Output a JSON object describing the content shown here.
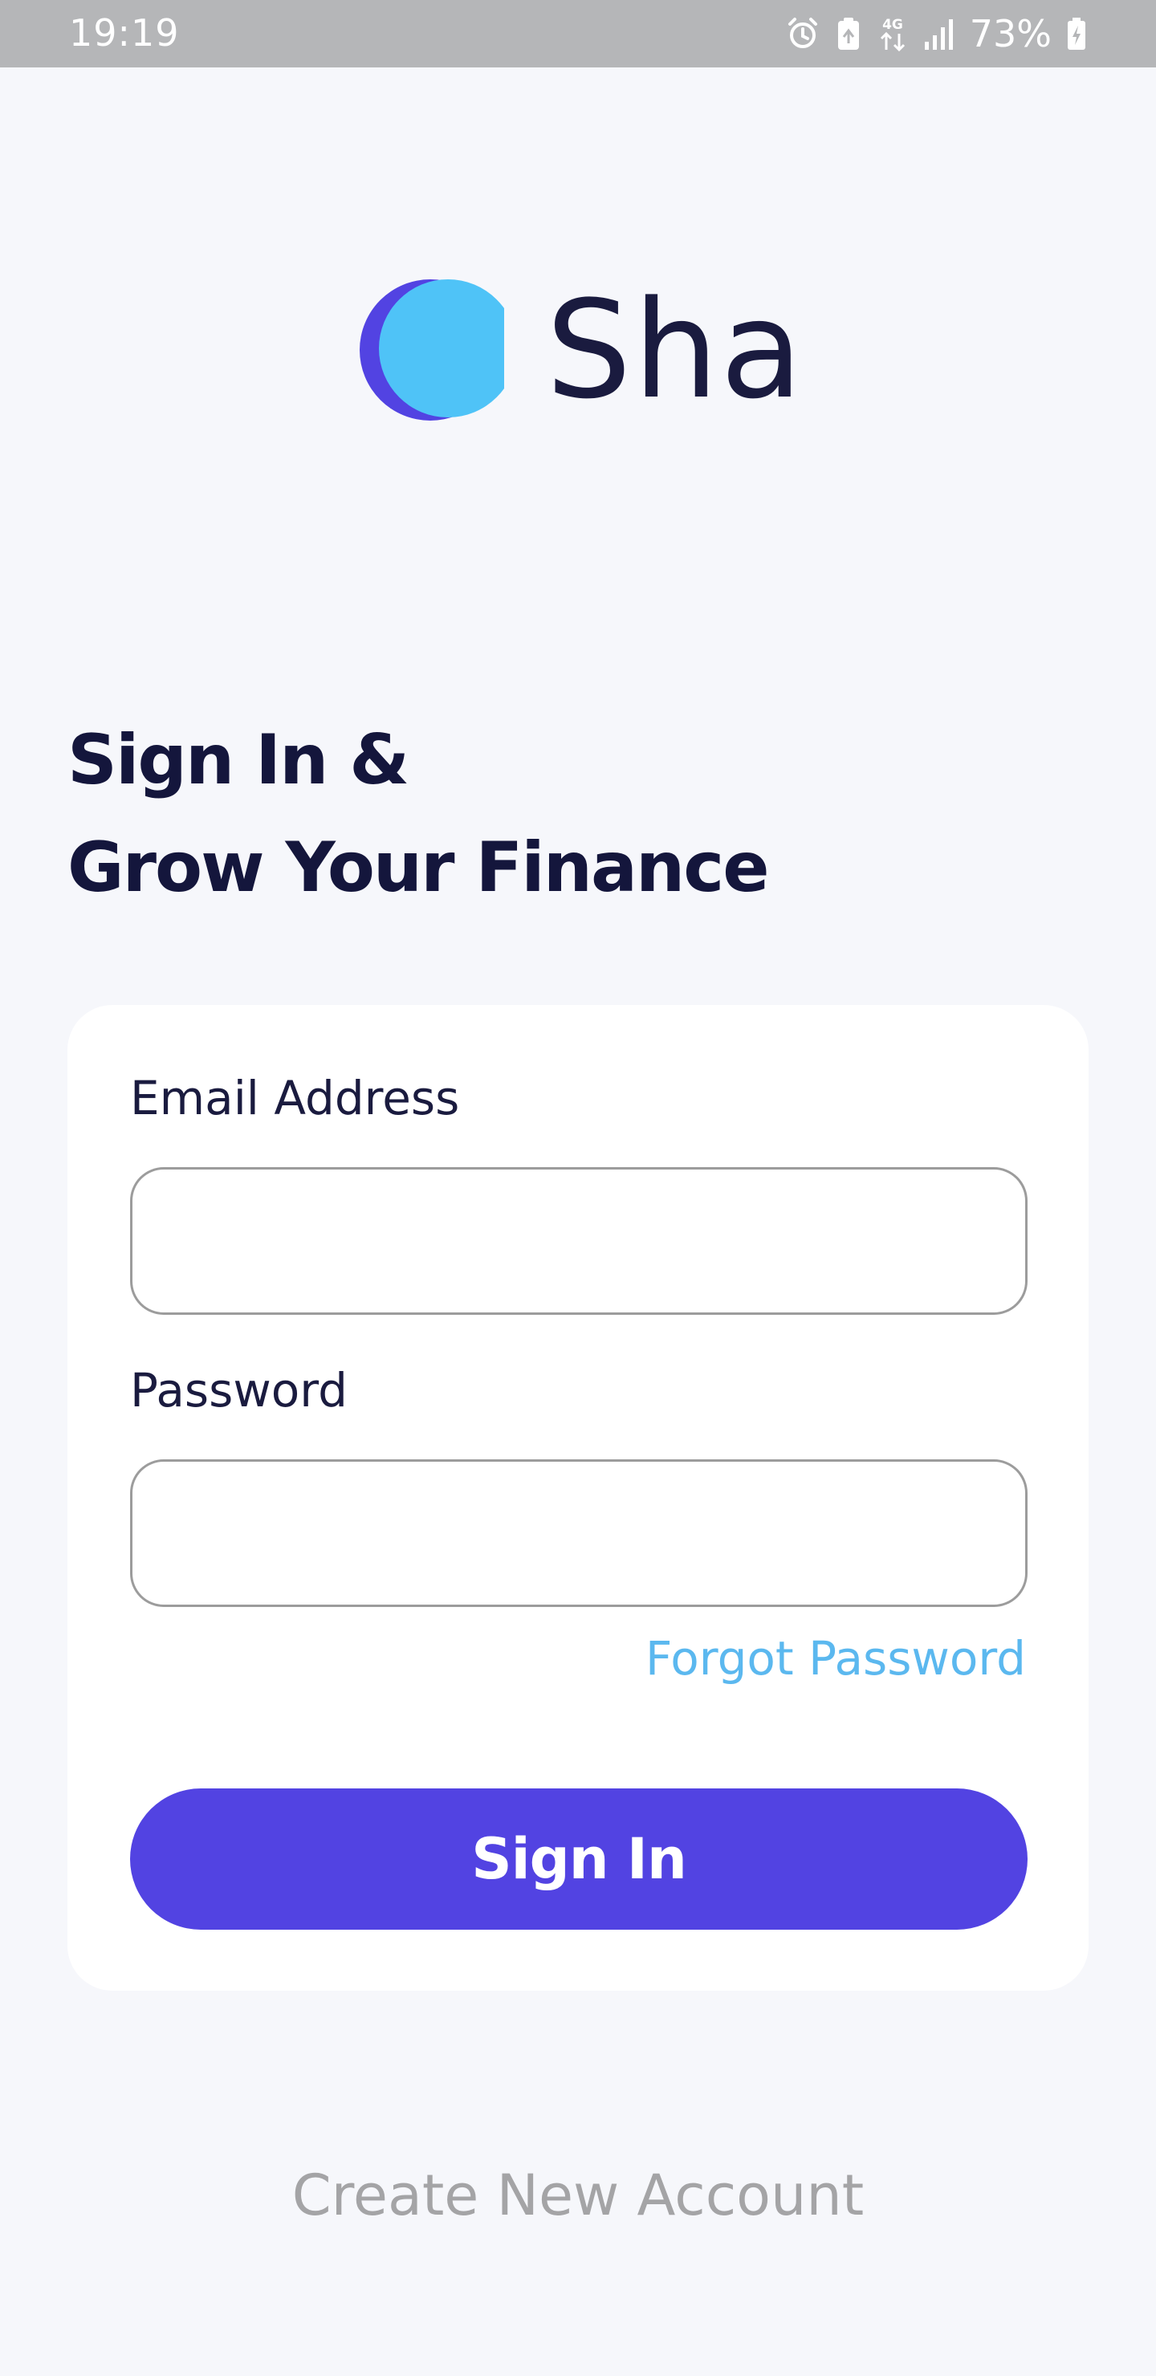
{
  "status_bar": {
    "time": "19:19",
    "network": "4G",
    "battery": "73%",
    "icons": [
      "alarm-icon",
      "battery-saver-icon",
      "network-4g-icon",
      "signal-icon",
      "battery-charging-icon"
    ]
  },
  "app": {
    "name": "Sha",
    "logo_colors": {
      "back": "#5243e2",
      "front": "#4fc3f7"
    }
  },
  "heading": {
    "line1": "Sign In &",
    "line2": "Grow Your Finance"
  },
  "form": {
    "email_label": "Email Address",
    "email_value": "",
    "password_label": "Password",
    "password_value": "",
    "forgot_label": "Forgot Password",
    "submit_label": "Sign In"
  },
  "footer": {
    "create_account_label": "Create New Account"
  },
  "colors": {
    "primary": "#5243e2",
    "link": "#5bb8ef",
    "heading": "#14163c",
    "background": "#f6f7fb",
    "status_bar": "#b5b6b8"
  }
}
